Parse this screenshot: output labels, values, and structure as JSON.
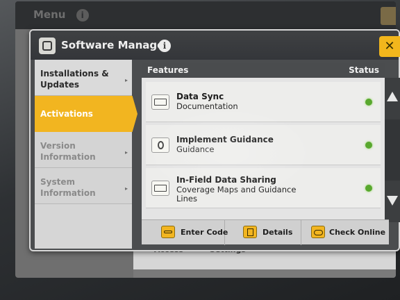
{
  "background_app": {
    "title": "Menu",
    "info_glyph": "i",
    "tabs": [
      "Access",
      "Settings"
    ]
  },
  "dialog": {
    "title": "Software Manager",
    "info_glyph": "i",
    "close_glyph": "✕"
  },
  "nav": {
    "items": [
      {
        "label_line1": "Installations &",
        "label_line2": "Updates",
        "state": "normal"
      },
      {
        "label_line1": "Activations",
        "label_line2": "",
        "state": "active"
      },
      {
        "label_line1": "Version",
        "label_line2": "Information",
        "state": "dim"
      },
      {
        "label_line1": "System",
        "label_line2": "Information",
        "state": "dim"
      }
    ],
    "arrow_glyph": "▸"
  },
  "features": {
    "header_label": "Features",
    "status_label": "Status",
    "items": [
      {
        "name": "Data Sync",
        "desc_line1": "Documentation",
        "desc_line2": "",
        "icon": "display-icon",
        "status_color": "#59a82e"
      },
      {
        "name": "Implement Guidance",
        "desc_line1": "Guidance",
        "desc_line2": "",
        "icon": "guidance-icon",
        "status_color": "#59a82e"
      },
      {
        "name": "In-Field Data Sharing",
        "desc_line1": "Coverage Maps and Guidance",
        "desc_line2": "Lines",
        "icon": "display-icon",
        "status_color": "#59a82e"
      }
    ]
  },
  "toolbar": {
    "enter_code": "Enter Code",
    "details": "Details",
    "check_online": "Check Online"
  },
  "colors": {
    "accent": "#f2b520",
    "status_ok": "#59a82e"
  }
}
